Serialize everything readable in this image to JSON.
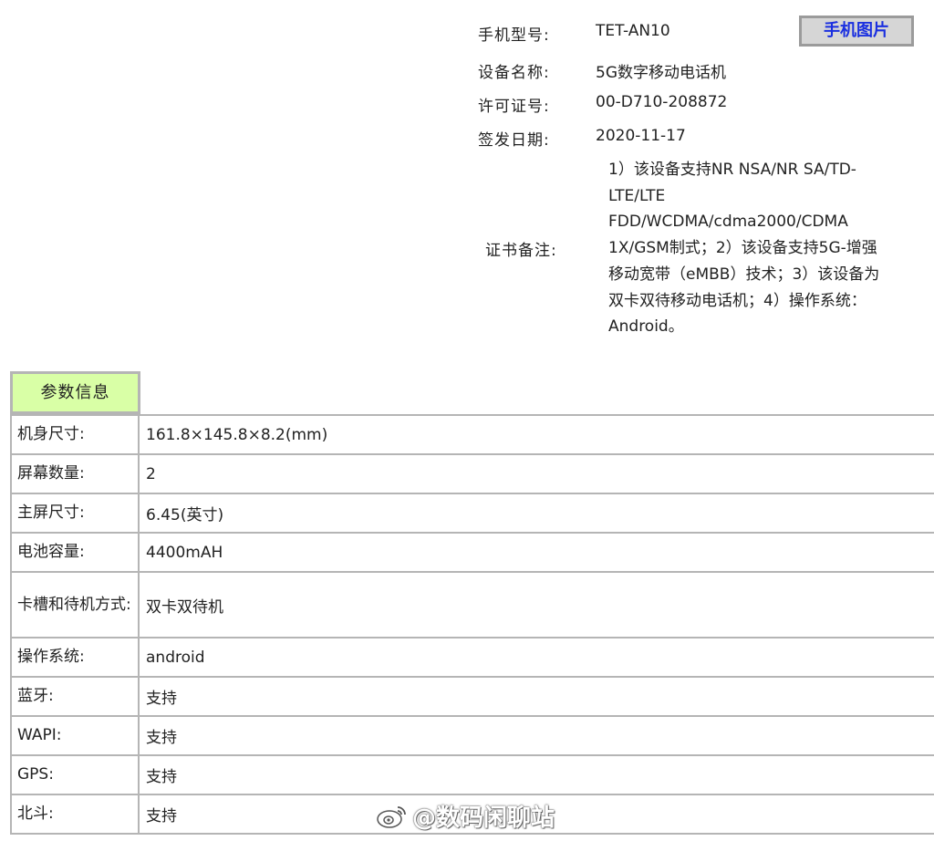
{
  "cert": {
    "model_label": "手机型号:",
    "model_value": "TET-AN10",
    "device_label": "设备名称:",
    "device_value": "5G数字移动电话机",
    "license_label": "许可证号:",
    "license_value": "00-D710-208872",
    "date_label": "签发日期:",
    "date_value": "2020-11-17",
    "remark_label": "证书备注:",
    "remark_text": "1）该设备支持NR NSA/NR SA/TD-\nLTE/LTE\nFDD/WCDMA/cdma2000/CDMA\n1X/GSM制式；2）该设备支持5G-增强\n移动宽带（eMBB）技术；3）该设备为\n双卡双待移动电话机；4）操作系统：\nAndroid。",
    "phone_image_button": "手机图片"
  },
  "params": {
    "header": "参数信息",
    "rows": [
      {
        "key": "机身尺寸:",
        "value": "161.8×145.8×8.2(mm)"
      },
      {
        "key": "屏幕数量:",
        "value": "2"
      },
      {
        "key": "主屏尺寸:",
        "value": "6.45(英寸)"
      },
      {
        "key": "电池容量:",
        "value": "4400mAH"
      },
      {
        "key": "卡槽和待机方式:",
        "value": "双卡双待机"
      },
      {
        "key": "操作系统:",
        "value": "android"
      },
      {
        "key": "蓝牙:",
        "value": "支持"
      },
      {
        "key": "WAPI:",
        "value": "支持"
      },
      {
        "key": "GPS:",
        "value": "支持"
      },
      {
        "key": "北斗:",
        "value": "支持"
      }
    ]
  },
  "watermark": {
    "text": "@数码闲聊站",
    "icon": "weibo-icon"
  },
  "colors": {
    "button_text": "#1a2fe0",
    "header_bg": "#d9ffa6",
    "border": "#b5b5b5"
  }
}
